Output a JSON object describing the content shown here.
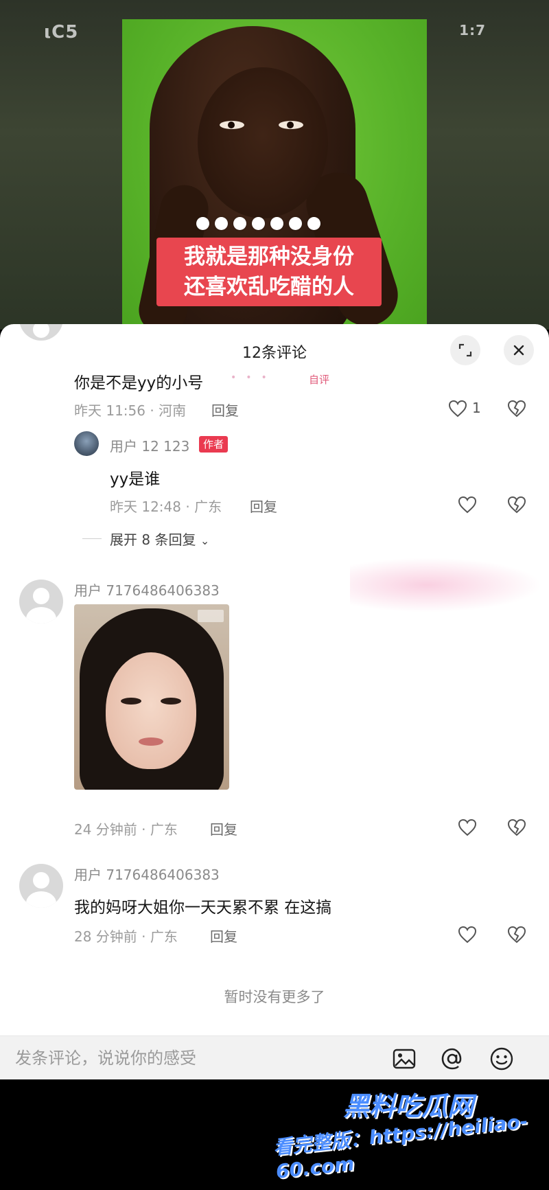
{
  "video": {
    "status_left": "ιC5",
    "status_right": "1:7",
    "caption_line1": "我就是那种没身份",
    "caption_line2": "还喜欢乱吃醋的人",
    "dot_count": 7
  },
  "sheet": {
    "title": "12条评论",
    "expand_icon": "expand-icon",
    "close_icon": "close-icon"
  },
  "comments": [
    {
      "text": "你是不是yy的小号",
      "tag": "自评",
      "time": "昨天 11:56 · 河南",
      "reply_label": "回复",
      "likes": "1"
    },
    {
      "username": "用户 12 123",
      "badge": "作者",
      "text": "yy是谁",
      "time": "昨天 12:48 · 广东",
      "reply_label": "回复"
    },
    {
      "username": "用户 7176486406383",
      "time": "24 分钟前 · 广东",
      "reply_label": "回复"
    },
    {
      "username": "用户 7176486406383",
      "text": "我的妈呀大姐你一天天累不累 在这搞",
      "time": "28 分钟前 · 广东",
      "reply_label": "回复"
    }
  ],
  "expand_replies": "展开 8 条回复",
  "no_more": "暂时没有更多了",
  "input": {
    "placeholder": "发条评论，说说你的感受",
    "icons": [
      "image-icon",
      "at-icon",
      "emoji-icon"
    ]
  },
  "watermark": {
    "brand": "黑料吃瓜网",
    "url": "看完整版：https://heiliao-60.com"
  },
  "colors": {
    "author_badge": "#ea3a50",
    "caption_bg": "#e8464f",
    "watermark": "#4b8dff"
  }
}
